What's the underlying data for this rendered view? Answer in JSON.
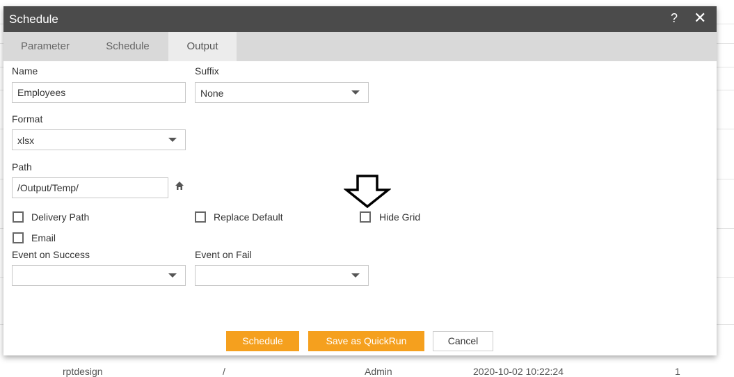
{
  "dialog": {
    "title": "Schedule",
    "help_label": "?",
    "close_label": "✕"
  },
  "tabs": [
    {
      "label": "Parameter",
      "active": false
    },
    {
      "label": "Schedule",
      "active": false
    },
    {
      "label": "Output",
      "active": true
    }
  ],
  "form": {
    "name_label": "Name",
    "name_value": "Employees",
    "suffix_label": "Suffix",
    "suffix_value": "None",
    "format_label": "Format",
    "format_value": "xlsx",
    "path_label": "Path",
    "path_value": "/Output/Temp/",
    "delivery_path_label": "Delivery Path",
    "delivery_path_checked": false,
    "replace_default_label": "Replace Default",
    "replace_default_checked": false,
    "hide_grid_label": "Hide Grid",
    "hide_grid_checked": false,
    "email_label": "Email",
    "email_checked": false,
    "event_success_label": "Event on Success",
    "event_success_value": "",
    "event_fail_label": "Event on Fail",
    "event_fail_value": ""
  },
  "buttons": {
    "schedule": "Schedule",
    "save_quickrun": "Save as QuickRun",
    "cancel": "Cancel"
  },
  "background_row": {
    "name": "rptdesign",
    "path": "/",
    "owner": "Admin",
    "date": "2020-10-02 10:22:24",
    "count": "1"
  },
  "colors": {
    "titlebar": "#4b4b4b",
    "tabbar": "#d9d9d9",
    "active_tab": "#ececec",
    "accent": "#f5a01e"
  },
  "icons": {
    "home": "home-icon",
    "arrow": "down-arrow-outline-icon"
  }
}
